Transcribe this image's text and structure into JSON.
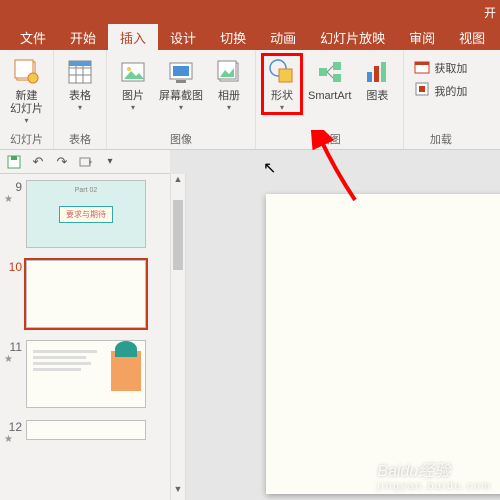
{
  "titlebar": {
    "right": "开"
  },
  "tabs": [
    {
      "label": "文件"
    },
    {
      "label": "开始"
    },
    {
      "label": "插入"
    },
    {
      "label": "设计"
    },
    {
      "label": "切换"
    },
    {
      "label": "动画"
    },
    {
      "label": "幻灯片放映"
    },
    {
      "label": "审阅"
    },
    {
      "label": "视图"
    }
  ],
  "active_tab": 2,
  "groups": {
    "slides": {
      "label": "幻灯片",
      "new_slide": "新建\n幻灯片"
    },
    "tables": {
      "label": "表格",
      "table": "表格"
    },
    "images": {
      "label": "图像",
      "picture": "图片",
      "screenshot": "屏幕截图",
      "album": "相册"
    },
    "illus": {
      "label": "插图",
      "shapes": "形状",
      "smartart": "SmartArt",
      "chart": "图表"
    },
    "addins": {
      "label": "加载",
      "get": "获取加",
      "my": "我的加"
    }
  },
  "thumbs": [
    {
      "num": "9",
      "star": "★",
      "title": "要求与期待",
      "part": "Part 02"
    },
    {
      "num": "10",
      "star": "",
      "blank": true
    },
    {
      "num": "11",
      "star": "★"
    },
    {
      "num": "12",
      "star": "★"
    }
  ],
  "selected_thumb": 1,
  "watermark": {
    "main": "Baidu经验",
    "sub": "jingyan.baidu.com"
  }
}
